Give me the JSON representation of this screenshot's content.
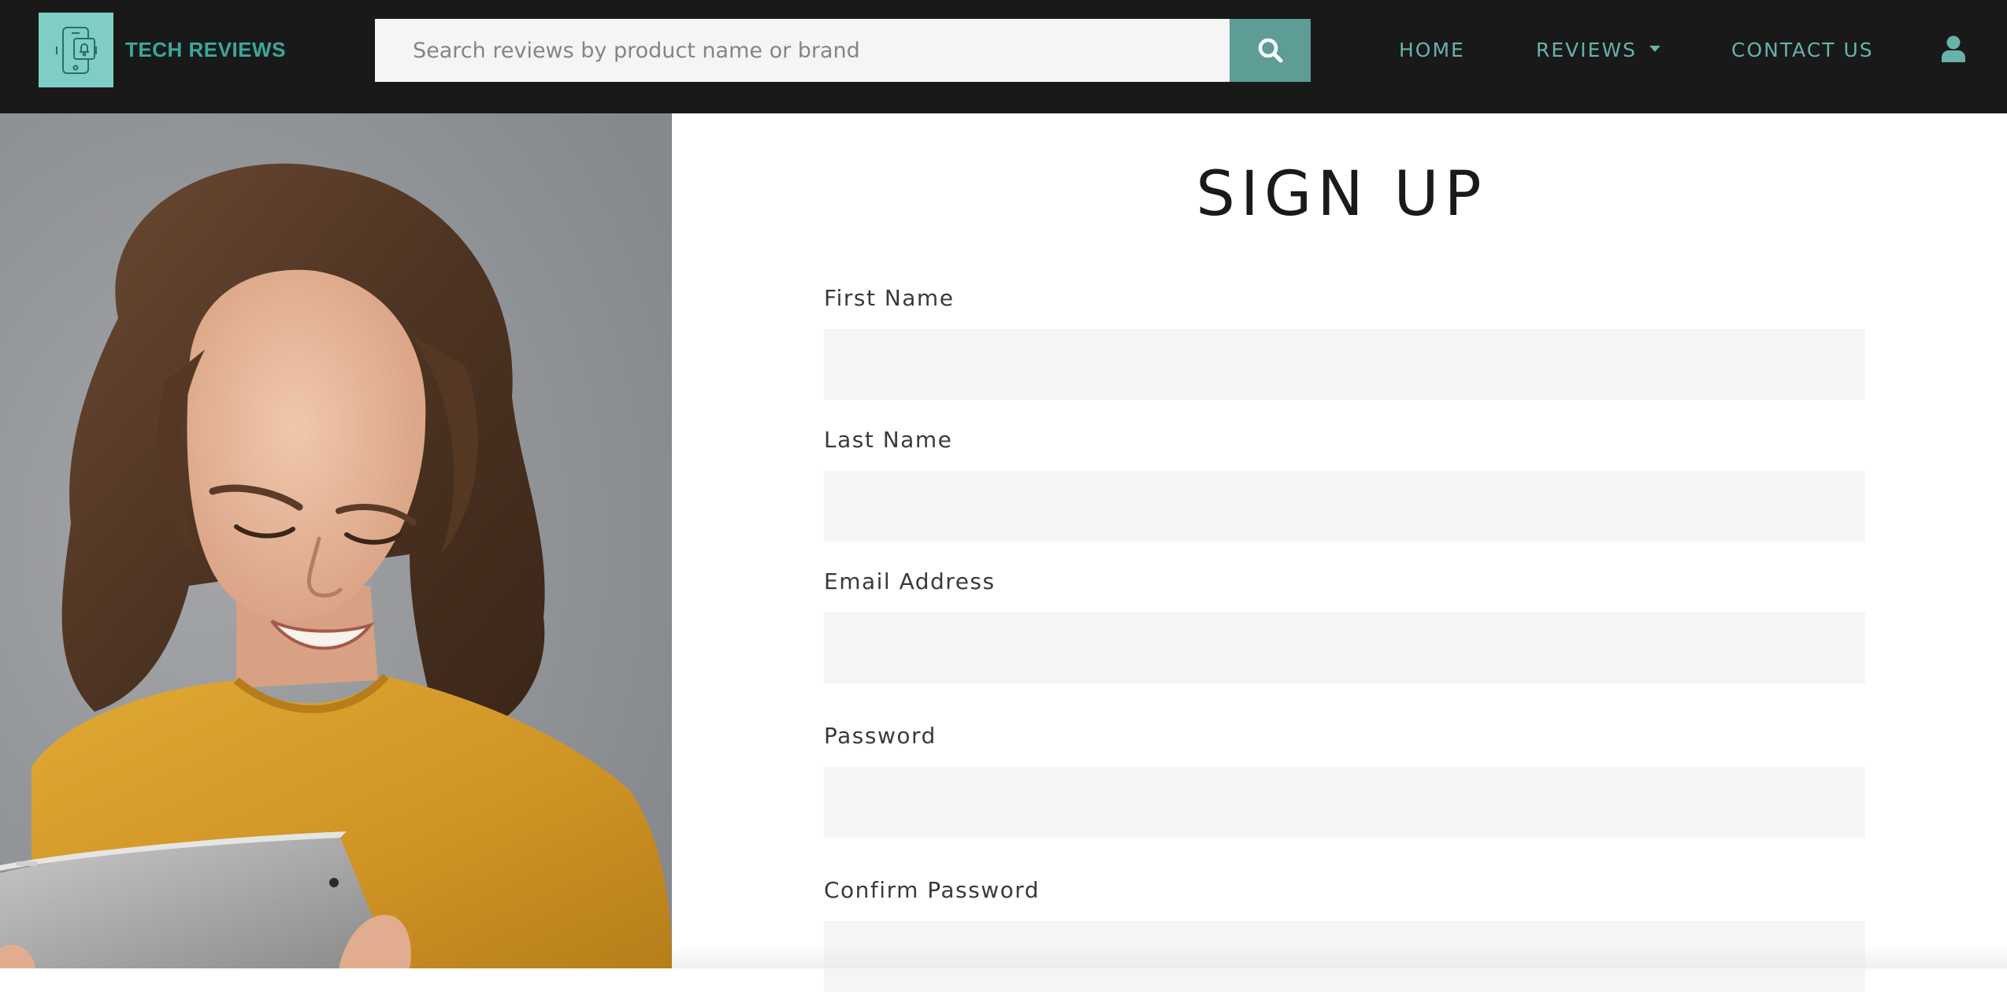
{
  "navbar": {
    "brand_name": "TECH REVIEWS",
    "brand_icon": "phone-bell-icon",
    "search": {
      "placeholder": "Search reviews by product name or brand",
      "value": "",
      "button_icon": "search-icon"
    },
    "links": {
      "home": "HOME",
      "reviews": "REVIEWS",
      "contact": "CONTACT US"
    },
    "user_icon": "user-icon"
  },
  "hero": {
    "image_icon": "woman-with-tablet-photo"
  },
  "form": {
    "title": "SIGN UP",
    "fields": [
      {
        "label": "First Name",
        "value": ""
      },
      {
        "label": "Last Name",
        "value": ""
      },
      {
        "label": "Email Address",
        "value": ""
      },
      {
        "label": "Password",
        "value": ""
      },
      {
        "label": "Confirm Password",
        "value": ""
      }
    ]
  },
  "colors": {
    "navbar_bg": "#191919",
    "accent": "#5e9c96",
    "brand_text": "#3aa89b",
    "logo_bg": "#7fcec4",
    "input_bg": "#f5f5f7",
    "sweater": "#d9a02b"
  }
}
